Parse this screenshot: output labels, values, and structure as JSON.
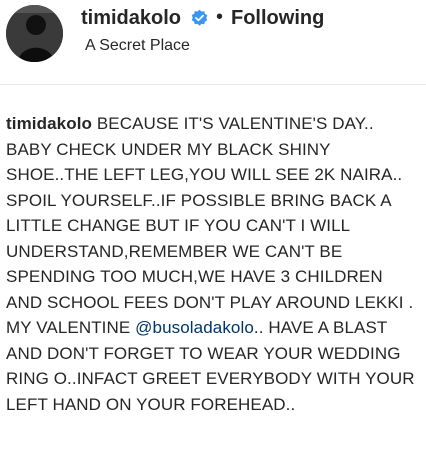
{
  "post": {
    "username": "timidakolo",
    "separator": "•",
    "follow_status": "Following",
    "location": "A Secret Place",
    "verified_icon": "verified-badge-icon",
    "colors": {
      "verified": "#3897f0",
      "mention": "#003569",
      "text": "#262626"
    }
  },
  "caption": {
    "author": "timidakolo",
    "text_before": " BECAUSE IT'S VALENTINE'S DAY.. BABY CHECK UNDER MY BLACK SHINY SHOE..THE LEFT LEG,YOU WILL SEE 2K NAIRA.. SPOIL YOURSELF..IF POSSIBLE BRING BACK A LITTLE CHANGE BUT IF YOU CAN'T I WILL UNDERSTAND,REMEMBER WE CAN'T BE SPENDING TOO MUCH,WE HAVE 3 CHILDREN AND SCHOOL FEES DON'T PLAY AROUND LEKKI . MY VALENTINE ",
    "mention": "@busoladakolo",
    "text_after": ".. HAVE A BLAST AND DON'T FORGET TO WEAR YOUR WEDDING RING O..INFACT GREET EVERYBODY WITH YOUR LEFT HAND ON YOUR FOREHEAD.."
  }
}
